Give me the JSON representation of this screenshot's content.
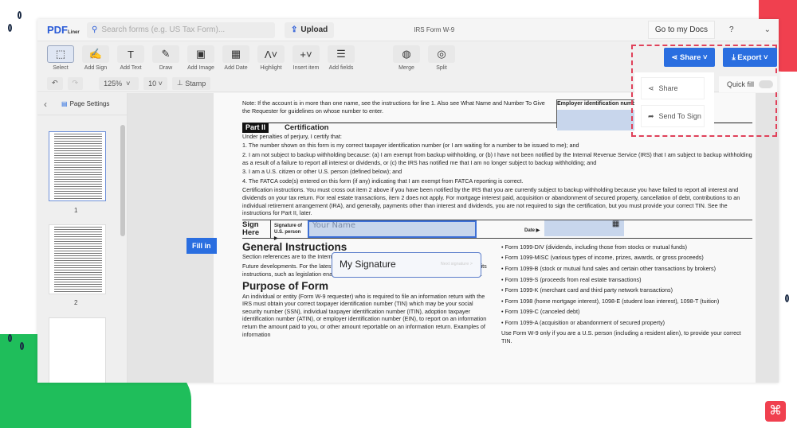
{
  "header": {
    "logo": "PDF",
    "logo_sub": "Liner",
    "search_placeholder": "Search forms (e.g. US Tax Form)...",
    "upload": "Upload",
    "doc_title": "IRS Form W-9",
    "go_to_docs": "Go to my Docs",
    "help": "?"
  },
  "toolbar": [
    {
      "label": "Select",
      "icon": "⬚"
    },
    {
      "label": "Add Sign",
      "icon": "✍"
    },
    {
      "label": "Add Text",
      "icon": "T"
    },
    {
      "label": "Draw",
      "icon": "✎"
    },
    {
      "label": "Add Image",
      "icon": "▣"
    },
    {
      "label": "Add Date",
      "icon": "▦"
    },
    {
      "label": "Highlight",
      "icon": "Ʌ˅"
    },
    {
      "label": "Insert item",
      "icon": "+˅"
    },
    {
      "label": "Add fields",
      "icon": "☰"
    },
    {
      "label": "Merge",
      "icon": "◍"
    },
    {
      "label": "Split",
      "icon": "◎"
    }
  ],
  "subtoolbar": {
    "zoom": "125%",
    "font_size": "10",
    "stamp": "Stamp"
  },
  "sidebar": {
    "page_settings": "Page Settings",
    "pages": [
      "1",
      "2"
    ]
  },
  "actions": {
    "share": "Share",
    "export": "Export",
    "menu": [
      "Share",
      "Send To Sign"
    ],
    "quick_fill": "Quick fill"
  },
  "fill_in": "Fill in",
  "signature_popup": {
    "label": "My Signature",
    "next": "Next signature >"
  },
  "document": {
    "ein_label": "Employer identification number",
    "note": "Note: If the account is in more than one name, see the instructions for line 1. Also see What Name and Number To Give the Requester for guidelines on whose number to enter.",
    "part": "Part II",
    "part_title": "Certification",
    "intro": "Under penalties of perjury, I certify that:",
    "items": [
      "1. The number shown on this form is my correct taxpayer identification number (or I am waiting for a number to be issued to me); and",
      "2. I am not subject to backup withholding because: (a) I am exempt from backup withholding, or (b) I have not been notified by the Internal Revenue Service (IRS) that I am subject to backup withholding as a result of a failure to report all interest or dividends, or (c) the IRS has notified me that I am no longer subject to backup withholding; and",
      "3. I am a U.S. citizen or other U.S. person (defined below); and",
      "4. The FATCA code(s) entered on this form (if any) indicating that I am exempt from FATCA reporting is correct."
    ],
    "cert_instructions": "Certification instructions. You must cross out item 2 above if you have been notified by the IRS that you are currently subject to backup withholding because you have failed to report all interest and dividends on your tax return. For real estate transactions, item 2 does not apply. For mortgage interest paid, acquisition or abandonment of secured property, cancellation of debt, contributions to an individual retirement arrangement (IRA), and generally, payments other than interest and dividends, you are not required to sign the certification, but you must provide your correct TIN. See the instructions for Part II, later.",
    "sign_here": "Sign Here",
    "signature_of": "Signature of U.S. person ▶",
    "your_name": "Your Name",
    "date": "Date ▶",
    "gen_title": "General Instructions",
    "gen_text": "Section references are to the Internal Revenue Code unless otherwise noted.",
    "future": "Future developments. For the latest information about developments related to Form W-9 and its instructions, such as legislation enacted after they were published, go to www.irs.gov/FormW9.",
    "purpose_title": "Purpose of Form",
    "purpose_text": "An individual or entity (Form W-9 requester) who is required to file an information return with the IRS must obtain your correct taxpayer identification number (TIN) which may be your social security number (SSN), individual taxpayer identification number (ITIN), adoption taxpayer identification number (ATIN), or employer identification number (EIN), to report on an information return the amount paid to you, or other amount reportable on an information return. Examples of information",
    "right_items": [
      "• Form 1099-DIV (dividends, including those from stocks or mutual funds)",
      "• Form 1099-MISC (various types of income, prizes, awards, or gross proceeds)",
      "• Form 1099-B (stock or mutual fund sales and certain other transactions by brokers)",
      "• Form 1099-S (proceeds from real estate transactions)",
      "• Form 1099-K (merchant card and third party network transactions)",
      "• Form 1098 (home mortgage interest), 1098-E (student loan interest), 1098-T (tuition)",
      "• Form 1099-C (canceled debt)",
      "• Form 1099-A (acquisition or abandonment of secured property)",
      "Use Form W-9 only if you are a U.S. person (including a resident alien), to provide your correct TIN."
    ]
  }
}
